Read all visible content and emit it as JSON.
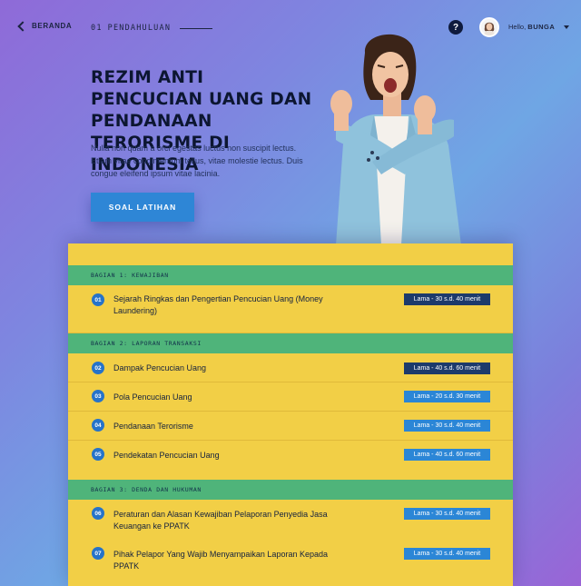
{
  "nav": {
    "back_label": "BERANDA",
    "crumb_num": "01",
    "crumb_label": "PENDAHULUAN",
    "help_symbol": "?",
    "hello_prefix": "Hello,",
    "username": "BUNGA"
  },
  "hero": {
    "title": "REZIM ANTI PENCUCIAN UANG DAN PENDANAAN TERORISME DI INDONESIA",
    "description": "Nulla non quam a orci egestas luctus non suscipit lectus. Etiam vitae condimentum tellus, vitae molestie lectus. Duis congue eleifend ipsum vitae lacinia.",
    "cta_label": "SOAL LATIHAN"
  },
  "colors": {
    "accent_blue": "#2e86d6",
    "card_yellow": "#f2cf46",
    "section_green": "#4fb47a",
    "badge_dark": "#1d3a6b",
    "badge_blue": "#2b86d6"
  },
  "sections": [
    {
      "label": "BAGIAN 1: KEWAJIBAN",
      "items": [
        {
          "num": "01",
          "name": "Sejarah Ringkas dan Pengertian Pencucian Uang (Money Laundering)",
          "duration": "Lama - 30 s.d. 40 menit",
          "style": "dark"
        }
      ]
    },
    {
      "label": "BAGIAN 2: LAPORAN TRANSAKSI",
      "items": [
        {
          "num": "02",
          "name": "Dampak Pencucian Uang",
          "duration": "Lama - 40 s.d. 60 menit",
          "style": "dark"
        },
        {
          "num": "03",
          "name": "Pola Pencucian Uang",
          "duration": "Lama - 20 s.d. 30 menit",
          "style": "blue"
        },
        {
          "num": "04",
          "name": "Pendanaan Terorisme",
          "duration": "Lama - 30 s.d. 40 menit",
          "style": "blue"
        },
        {
          "num": "05",
          "name": "Pendekatan Pencucian Uang",
          "duration": "Lama - 40 s.d. 60 menit",
          "style": "blue"
        }
      ]
    },
    {
      "label": "BAGIAN 3: DENDA DAN HUKUMAN",
      "items": [
        {
          "num": "06",
          "name": "Peraturan dan Alasan Kewajiban Pelaporan Penyedia Jasa Keuangan ke PPATK",
          "duration": "Lama - 30 s.d. 40 menit",
          "style": "blue"
        },
        {
          "num": "07",
          "name": "Pihak Pelapor Yang Wajib Menyampaikan Laporan Kepada PPATK",
          "duration": "Lama - 30 s.d. 40 menit",
          "style": "blue"
        }
      ]
    }
  ]
}
